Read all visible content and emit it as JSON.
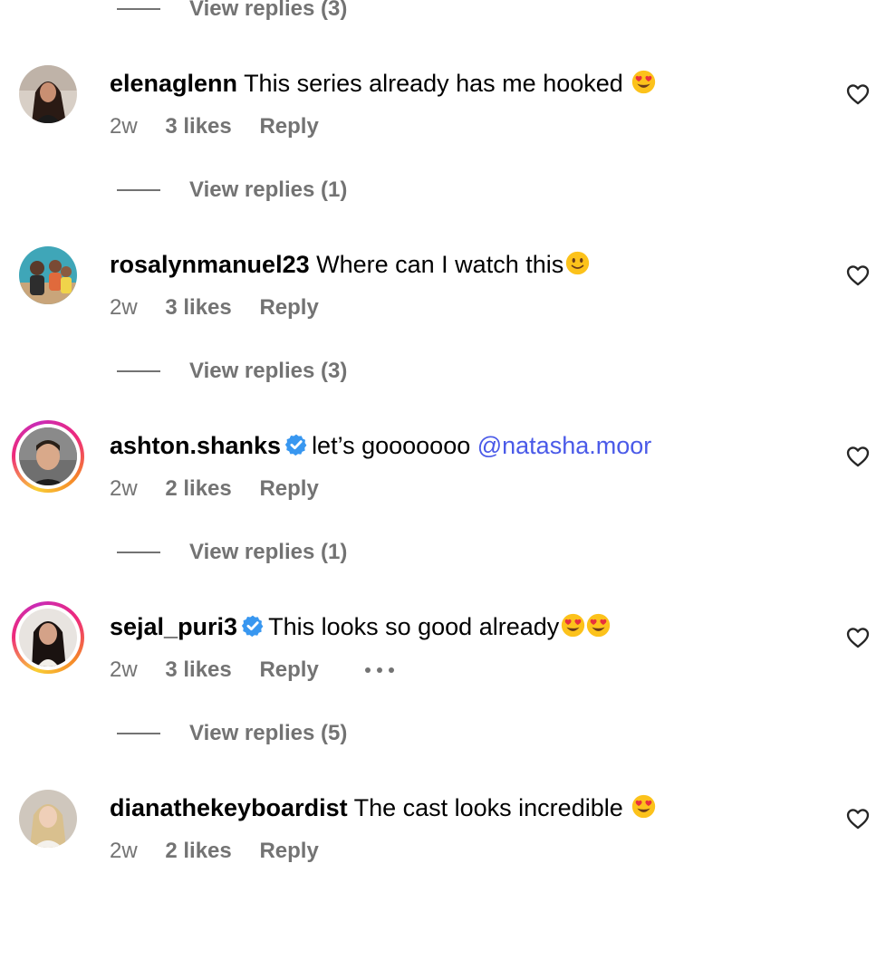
{
  "top_replies": {
    "label": "View replies (3)"
  },
  "comments": [
    {
      "username": "elenaglenn",
      "text": "This series already has me hooked ",
      "emoji": [
        "heart-eyes"
      ],
      "time": "2w",
      "likes": "3 likes",
      "reply": "Reply",
      "replies_label": "View replies (1)"
    },
    {
      "username": "rosalynmanuel23",
      "text": "Where can I watch this",
      "emoji": [
        "slight-smile"
      ],
      "time": "2w",
      "likes": "3 likes",
      "reply": "Reply",
      "replies_label": "View replies (3)"
    },
    {
      "username": "ashton.shanks",
      "verified": true,
      "text": "let’s gooooooo ",
      "mention": "@natasha.moor",
      "time": "2w",
      "likes": "2 likes",
      "reply": "Reply",
      "replies_label": "View replies (1)"
    },
    {
      "username": "sejal_puri3",
      "verified": true,
      "text": "This looks so good already",
      "emoji": [
        "heart-eyes",
        "heart-eyes"
      ],
      "time": "2w",
      "likes": "3 likes",
      "reply": "Reply",
      "more": "more-options-icon",
      "replies_label": "View replies (5)"
    },
    {
      "username": "dianathekeyboardist",
      "text": "The cast looks incredible ",
      "emoji": [
        "heart-eyes"
      ],
      "time": "2w",
      "likes": "2 likes",
      "reply": "Reply"
    }
  ],
  "colors": {
    "secondary_text": "#737373",
    "mention": "#4a5ae8",
    "verified": "#3897f0"
  }
}
